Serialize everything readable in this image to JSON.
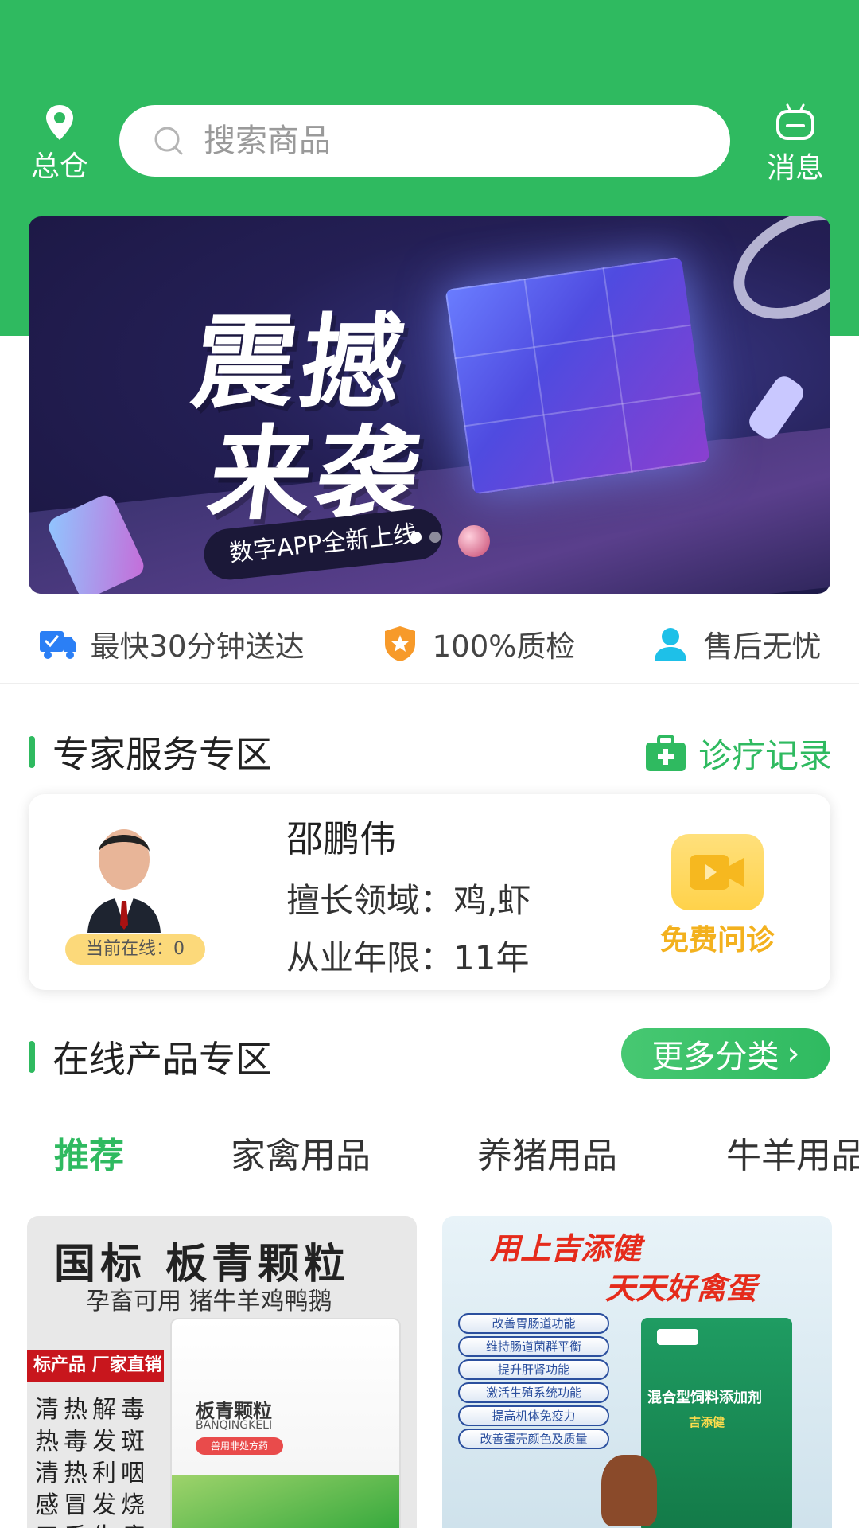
{
  "header": {
    "location_label": "总仓",
    "search_placeholder": "搜索商品",
    "message_label": "消息"
  },
  "banner": {
    "headline_line1": "震撼",
    "headline_line2": "来袭",
    "subtitle": "数字APP全新上线",
    "active_slide": 1,
    "slide_count": 2
  },
  "features": [
    {
      "icon": "delivery-truck-icon",
      "label": "最快30分钟送达"
    },
    {
      "icon": "quality-shield-icon",
      "label": "100%质检"
    },
    {
      "icon": "user-service-icon",
      "label": "售后无忧"
    }
  ],
  "expert_zone": {
    "title": "专家服务专区",
    "record_label": "诊疗记录",
    "expert": {
      "name": "邵鹏伟",
      "field_line": "擅长领域：鸡,虾",
      "years_line": "从业年限：11年",
      "online_status": "当前在线：0",
      "consult_label": "免费问诊"
    }
  },
  "product_zone": {
    "title": "在线产品专区",
    "more_label": "更多分类",
    "tabs": [
      {
        "label": "推荐",
        "active": true
      },
      {
        "label": "家禽用品",
        "active": false
      },
      {
        "label": "养猪用品",
        "active": false
      },
      {
        "label": "牛羊用品",
        "active": false
      }
    ],
    "products": [
      {
        "headline": "国标 板青颗粒",
        "subline": "孕畜可用 猪牛羊鸡鸭鹅",
        "tag": "标产品 厂家直销",
        "benefits": [
          "清热解毒",
          "热毒发斑",
          "清热利咽",
          "感冒发烧",
          "口舌生疮"
        ],
        "package_name": "板青颗粒",
        "package_pinyin": "BANQINGKELI",
        "package_badge": "兽用非处方药"
      },
      {
        "headline_line1": "用上吉添健",
        "headline_line2": "天天好禽蛋",
        "benefits": [
          "改善胃肠道功能",
          "维持肠道菌群平衡",
          "提升肝肾功能",
          "激活生殖系统功能",
          "提高机体免疫力",
          "改善蛋壳颜色及质量"
        ],
        "package_name": "混合型饲料添加剂",
        "package_brand": "吉添健"
      }
    ]
  },
  "colors": {
    "brand_green": "#2fba60",
    "consult_yellow": "#f3b11e",
    "online_badge": "#fcd97a"
  }
}
